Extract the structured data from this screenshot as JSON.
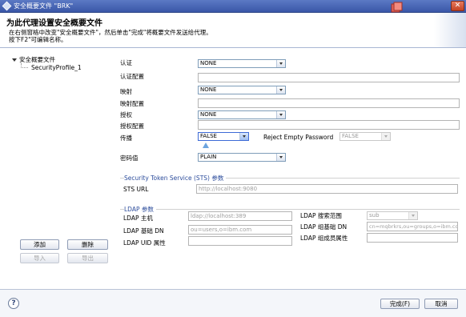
{
  "window": {
    "title": "安全概要文件 \"BRK\""
  },
  "header": {
    "title": "为此代理设置安全概要文件",
    "description_line1": "在右侧窗格中改变\"安全概要文件\"，然后单击\"完成\"将概要文件发送给代理。",
    "description_line2": "按下F2\"可编辑名称。"
  },
  "tree": {
    "root": "安全概要文件",
    "child": "SecurityProfile_1"
  },
  "form": {
    "auth": {
      "label": "认证",
      "value": "NONE"
    },
    "auth_config": {
      "label": "认证配置",
      "value": ""
    },
    "mapping": {
      "label": "映射",
      "value": "NONE"
    },
    "mapping_config": {
      "label": "映射配置",
      "value": ""
    },
    "authz": {
      "label": "授权",
      "value": "NONE"
    },
    "authz_config": {
      "label": "授权配置",
      "value": ""
    },
    "propagation": {
      "label": "传播",
      "value": "FALSE"
    },
    "reject_empty_password": {
      "label": "Reject Empty Password",
      "value": "FALSE"
    },
    "password_value": {
      "label": "密码值",
      "value": "PLAIN"
    }
  },
  "sts": {
    "group_title": "Security Token Service (STS) 参数",
    "url_label": "STS URL",
    "url_value": "http://localhost:9080"
  },
  "ldap": {
    "group_title": "LDAP 参数",
    "host_label": "LDAP 主机",
    "host_value": "ldap://localhost:389",
    "base_dn_label": "LDAP 基础 DN",
    "base_dn_value": "ou=users,o=ibm.com",
    "uid_attr_label": "LDAP UID 属性",
    "uid_attr_value": "",
    "search_scope_label": "LDAP 搜索范围",
    "search_scope_value": "sub",
    "group_base_dn_label": "LDAP 组基础 DN",
    "group_base_dn_value": "cn=mqbrkrs,ou=groups,o=ibm.com",
    "group_member_attr_label": "LDAP 组成员属性",
    "group_member_attr_value": ""
  },
  "left_buttons": {
    "add": "添加",
    "delete": "删除",
    "import": "导入",
    "export": "导出"
  },
  "footer": {
    "finish": "完成(F)",
    "cancel": "取消"
  }
}
